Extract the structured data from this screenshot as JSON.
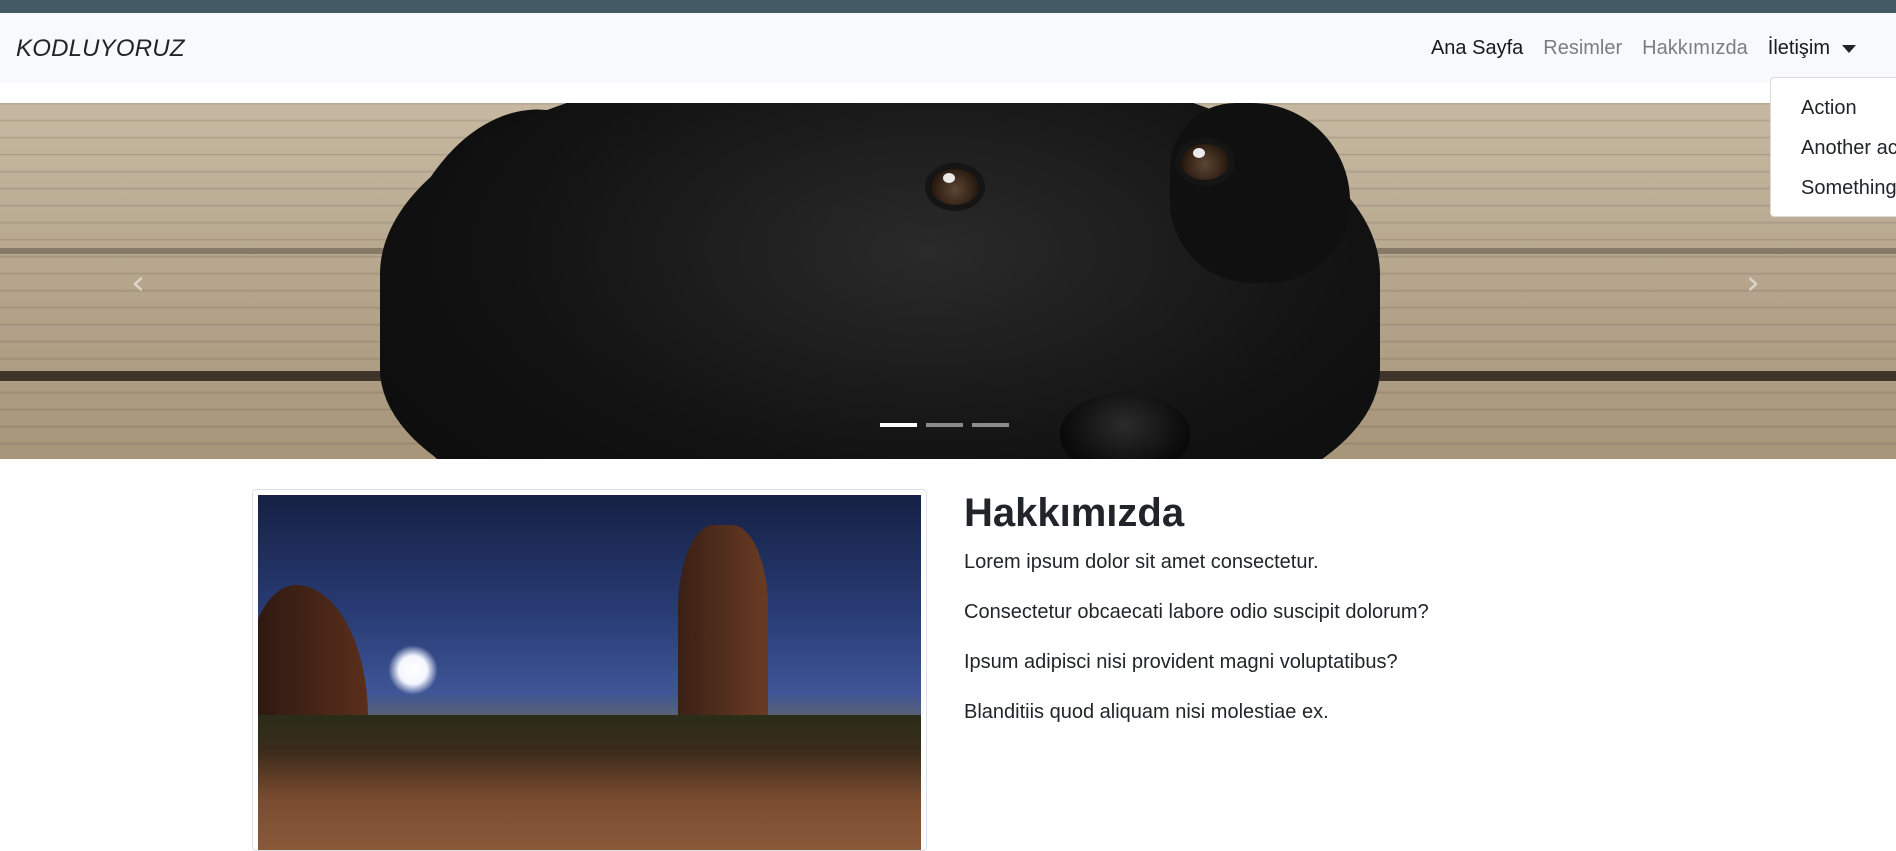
{
  "header": {
    "brand": "KODLUYORUZ",
    "nav": [
      {
        "label": "Ana Sayfa"
      },
      {
        "label": "Resimler"
      },
      {
        "label": "Hakkımızda"
      },
      {
        "label": "İletişim"
      }
    ],
    "dropdown_items": [
      {
        "label": "Action"
      },
      {
        "label": "Another action"
      },
      {
        "label": "Something else here"
      }
    ]
  },
  "carousel": {
    "prev_icon": "chevron-left-icon",
    "next_icon": "chevron-right-icon",
    "indicator_count": 3,
    "active_indicator": 0
  },
  "about": {
    "title": "Hakkımızda",
    "paragraphs": [
      "Lorem ipsum dolor sit amet consectetur.",
      "Consectetur obcaecati labore odio suscipit dolorum?",
      "Ipsum adipisci nisi provident magni voluptatibus?",
      "Blanditiis quod aliquam nisi molestiae ex."
    ]
  },
  "colors": {
    "top_strip": "#445a64",
    "navbar_bg": "#f8f9fa",
    "text": "#212529"
  }
}
